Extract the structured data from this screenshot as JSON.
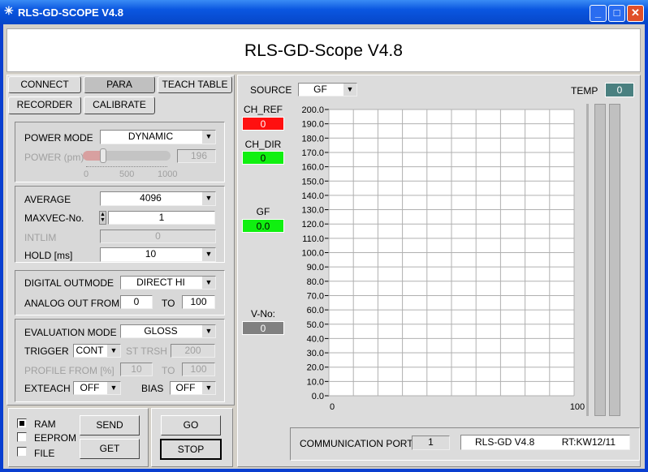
{
  "window": {
    "title": "RLS-GD-SCOPE V4.8",
    "app_icon": "sparkle-icon",
    "controls": [
      "minimize-icon",
      "maximize-icon",
      "close-icon"
    ]
  },
  "header": {
    "title": "RLS-GD-Scope V4.8"
  },
  "tabs": [
    {
      "label": "CONNECT"
    },
    {
      "label": "PARA",
      "selected": true
    },
    {
      "label": "TEACH TABLE"
    },
    {
      "label": "RECORDER"
    },
    {
      "label": "CALIBRATE"
    }
  ],
  "power": {
    "mode_label": "POWER MODE",
    "mode_value": "DYNAMIC",
    "power_label": "POWER (pm)",
    "power_value": "196",
    "slider_fraction": 0.196,
    "scale": [
      "0",
      "500",
      "1000"
    ]
  },
  "acq": {
    "average_label": "AVERAGE",
    "average_value": "4096",
    "maxvec_label": "MAXVEC-No.",
    "maxvec_value": "1",
    "intlim_label": "INTLIM",
    "intlim_value": "0",
    "hold_label": "HOLD [ms]",
    "hold_value": "10"
  },
  "output": {
    "digital_label": "DIGITAL OUTMODE",
    "digital_value": "DIRECT HI",
    "analog_label": "ANALOG OUT FROM",
    "analog_from": "0",
    "to_label": "TO",
    "analog_to": "100"
  },
  "eval": {
    "mode_label": "EVALUATION MODE",
    "mode_value": "GLOSS",
    "trigger_label": "TRIGGER",
    "trigger_value": "CONT",
    "sttrsh_label": "ST TRSH",
    "sttrsh_value": "200",
    "profile_label": "PROFILE FROM [%]",
    "profile_from": "10",
    "to_label": "TO",
    "profile_to": "100",
    "exteach_label": "EXTEACH",
    "exteach_value": "OFF",
    "bias_label": "BIAS",
    "bias_value": "OFF"
  },
  "memory": {
    "options": [
      {
        "label": "RAM",
        "checked": true
      },
      {
        "label": "EEPROM",
        "checked": false
      },
      {
        "label": "FILE",
        "checked": false
      }
    ],
    "send": "SEND",
    "get": "GET"
  },
  "run": {
    "go": "GO",
    "stop": "STOP"
  },
  "scope": {
    "source_label": "SOURCE",
    "source_value": "GF",
    "temp_label": "TEMP",
    "temp_value": "0",
    "indicators": [
      {
        "label": "CH_REF",
        "value": "0",
        "color": "#ff1010"
      },
      {
        "label": "CH_DIR",
        "value": "0",
        "color": "#10f010"
      },
      {
        "label": "GF",
        "value": "0.0",
        "color": "#10f010"
      },
      {
        "label": "V-No:",
        "value": "0",
        "color": "#808080"
      }
    ]
  },
  "chart_data": {
    "type": "line",
    "series": [],
    "xlim": [
      0,
      100
    ],
    "ylim": [
      0,
      200
    ],
    "x_tick_labels": [
      "0",
      "100"
    ],
    "y_tick_labels": [
      "200.0",
      "190.0",
      "180.0",
      "170.0",
      "160.0",
      "150.0",
      "140.0",
      "130.0",
      "120.0",
      "110.0",
      "100.0",
      "90.0",
      "80.0",
      "70.0",
      "60.0",
      "50.0",
      "40.0",
      "30.0",
      "20.0",
      "10.0",
      "0.0"
    ],
    "grid": true
  },
  "status": {
    "port_label": "COMMUNICATION PORT",
    "port_value": "1",
    "version": "RLS-GD V4.8",
    "build": "RT:KW12/11"
  }
}
